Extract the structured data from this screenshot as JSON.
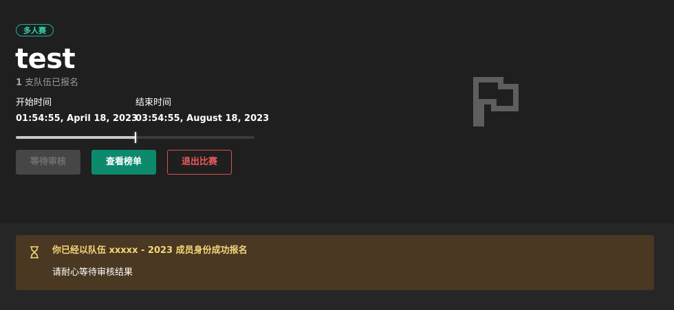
{
  "contest": {
    "mode_badge": "多人赛",
    "title": "test",
    "teams_count": "1",
    "teams_suffix": " 支队伍已报名"
  },
  "schedule": {
    "start_label": "开始时间",
    "start_value": "01:54:55, April 18, 2023",
    "end_label": "结束时间",
    "end_value": "03:54:55, August 18, 2023",
    "progress_fraction": 0.5
  },
  "actions": {
    "wait_review_label": "等待审核",
    "view_ranking_label": "查看榜单",
    "quit_label": "退出比赛"
  },
  "icons": {
    "hero": "flag-icon",
    "notice": "hourglass-icon"
  },
  "notice": {
    "title": "你已经以队伍 xxxxx - 2023 成员身份成功报名",
    "body": "请耐心等待审核结果"
  },
  "colors": {
    "accent": "#0d8a6e",
    "badge": "#16b896",
    "danger": "#d9534f",
    "notice_bg": "#4a3822",
    "notice_title": "#f5d77a"
  }
}
